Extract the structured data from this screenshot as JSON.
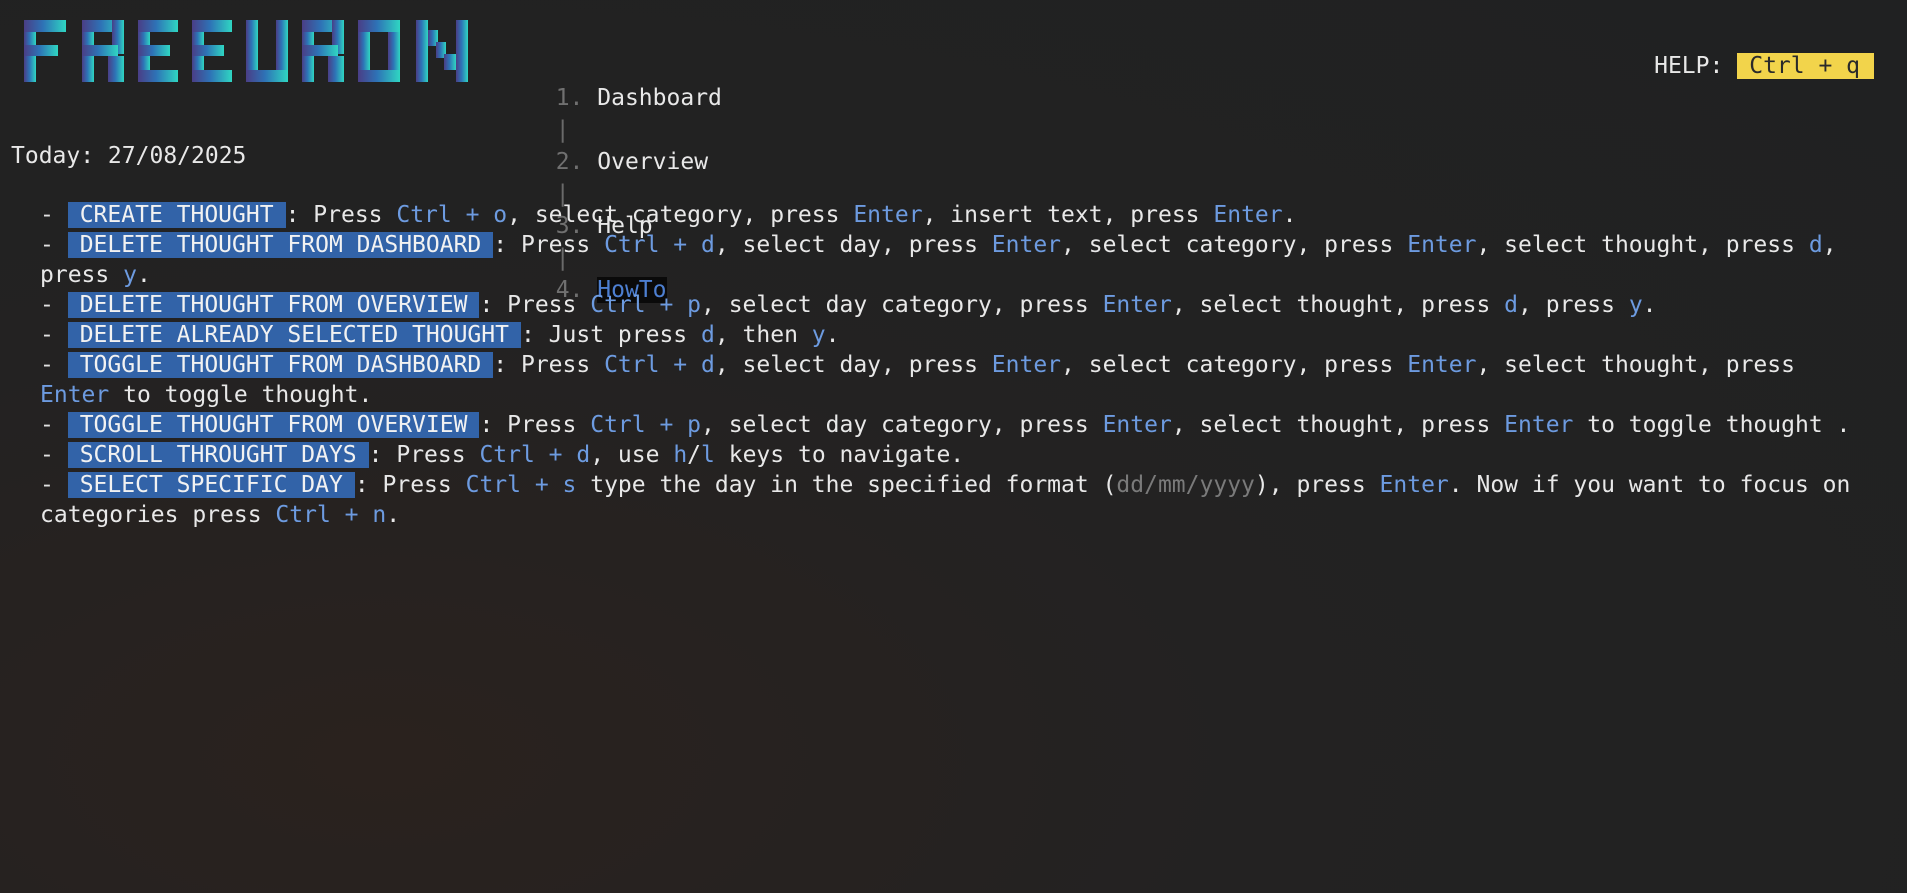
{
  "app": {
    "logo_text": "FREEURON"
  },
  "nav": {
    "items": [
      {
        "num": "1.",
        "label": "Dashboard"
      },
      {
        "num": "2.",
        "label": "Overview"
      },
      {
        "num": "3.",
        "label": "Help"
      },
      {
        "num": "4.",
        "label": "HowTo"
      }
    ],
    "separator": "|",
    "active_index": 3
  },
  "help": {
    "label": "HELP:",
    "shortcut": "Ctrl + q"
  },
  "today": "Today: 27/08/2025",
  "colors": {
    "accent": "#3263a8",
    "key": "#6d9be0",
    "help_bg": "#f2d44b"
  },
  "howto": [
    {
      "tag": "CREATE THOUGHT",
      "text": [
        [
          ": Press ",
          "t"
        ],
        [
          "Ctrl + o",
          "k"
        ],
        [
          ", select category, press ",
          "t"
        ],
        [
          "Enter",
          "k"
        ],
        [
          ", insert text, press ",
          "t"
        ],
        [
          "Enter",
          "k"
        ],
        [
          ".",
          "t"
        ]
      ]
    },
    {
      "tag": "DELETE THOUGHT FROM DASHBOARD",
      "text": [
        [
          ": Press ",
          "t"
        ],
        [
          "Ctrl + d",
          "k"
        ],
        [
          ", select day, press ",
          "t"
        ],
        [
          "Enter",
          "k"
        ],
        [
          ", select category, press ",
          "t"
        ],
        [
          "Enter",
          "k"
        ],
        [
          ", select thought, press ",
          "t"
        ],
        [
          "d",
          "k"
        ],
        [
          ", press ",
          "t"
        ],
        [
          "y",
          "k"
        ],
        [
          ".",
          "t"
        ]
      ]
    },
    {
      "tag": "DELETE THOUGHT FROM OVERVIEW",
      "text": [
        [
          ": Press ",
          "t"
        ],
        [
          "Ctrl + p",
          "k"
        ],
        [
          ", select day category, press ",
          "t"
        ],
        [
          "Enter",
          "k"
        ],
        [
          ", select thought, press ",
          "t"
        ],
        [
          "d",
          "k"
        ],
        [
          ", press ",
          "t"
        ],
        [
          "y",
          "k"
        ],
        [
          ".",
          "t"
        ]
      ]
    },
    {
      "tag": "DELETE ALREADY SELECTED THOUGHT",
      "text": [
        [
          ": Just press ",
          "t"
        ],
        [
          "d",
          "k"
        ],
        [
          ", then ",
          "t"
        ],
        [
          "y",
          "k"
        ],
        [
          ".",
          "t"
        ]
      ]
    },
    {
      "tag": "TOGGLE THOUGHT FROM DASHBOARD",
      "text": [
        [
          ": Press ",
          "t"
        ],
        [
          "Ctrl + d",
          "k"
        ],
        [
          ", select day, press ",
          "t"
        ],
        [
          "Enter",
          "k"
        ],
        [
          ", select category, press ",
          "t"
        ],
        [
          "Enter",
          "k"
        ],
        [
          ", select thought, press ",
          "t"
        ],
        [
          "Enter",
          "k"
        ],
        [
          " to toggle thought.",
          "t"
        ]
      ]
    },
    {
      "tag": "TOGGLE THOUGHT FROM OVERVIEW",
      "text": [
        [
          ": Press ",
          "t"
        ],
        [
          "Ctrl + p",
          "k"
        ],
        [
          ", select day category, press ",
          "t"
        ],
        [
          "Enter",
          "k"
        ],
        [
          ", select thought, press ",
          "t"
        ],
        [
          "Enter",
          "k"
        ],
        [
          " to toggle thought .",
          "t"
        ]
      ]
    },
    {
      "tag": "SCROLL THROUGHT DAYS",
      "text": [
        [
          ": Press ",
          "t"
        ],
        [
          "Ctrl + d",
          "k"
        ],
        [
          ", use ",
          "t"
        ],
        [
          "h",
          "k"
        ],
        [
          "/",
          "t"
        ],
        [
          "l",
          "k"
        ],
        [
          " keys to navigate.",
          "t"
        ]
      ]
    },
    {
      "tag": "SELECT SPECIFIC DAY",
      "text": [
        [
          ": Press ",
          "t"
        ],
        [
          "Ctrl + s",
          "k"
        ],
        [
          " type the day in the specified format (",
          "t"
        ],
        [
          "dd/mm/yyyy",
          "g"
        ],
        [
          "), press ",
          "t"
        ],
        [
          "Enter",
          "k"
        ],
        [
          ". Now if you want to focus on categories press ",
          "t"
        ],
        [
          "Ctrl + n",
          "k"
        ],
        [
          ".",
          "t"
        ]
      ]
    }
  ]
}
